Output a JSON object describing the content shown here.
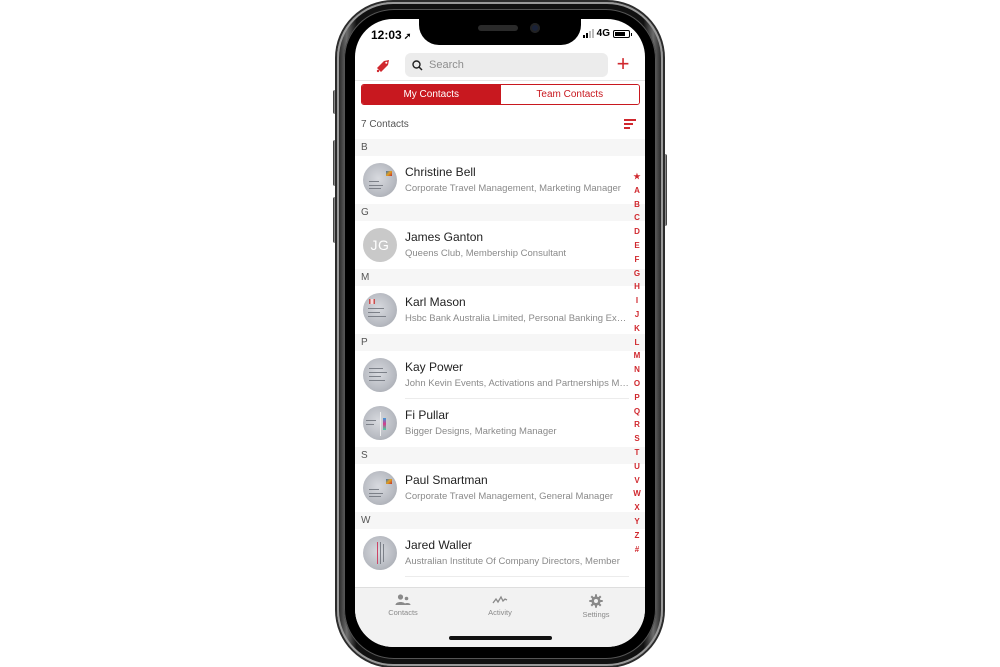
{
  "status_bar": {
    "time": "12:03",
    "location_glyph": "➚",
    "network": "4G",
    "battery_level": 0.8
  },
  "top_bar": {
    "left_icon": "tag-icon",
    "search_placeholder": "Search",
    "search_value": "",
    "add_icon": "plus-icon",
    "add_glyph": "+"
  },
  "segment": {
    "tabs": [
      {
        "label": "My Contacts",
        "active": true
      },
      {
        "label": "Team Contacts",
        "active": false
      }
    ]
  },
  "list_header": {
    "count_label": "7 Contacts",
    "sort_icon": "sort-icon"
  },
  "sections": [
    {
      "letter": "B",
      "contacts": [
        {
          "name": "Christine Bell",
          "subtitle": "Corporate Travel Management, Marketing Manager",
          "avatar": "card"
        }
      ]
    },
    {
      "letter": "G",
      "contacts": [
        {
          "name": "James Ganton",
          "subtitle": "Queens Club, Membership Consultant",
          "avatar": "initials",
          "initials": "JG"
        }
      ]
    },
    {
      "letter": "M",
      "contacts": [
        {
          "name": "Karl Mason",
          "subtitle": "Hsbc Bank Australia Limited, Personal Banking Executive",
          "avatar": "card"
        }
      ]
    },
    {
      "letter": "P",
      "contacts": [
        {
          "name": "Kay Power",
          "subtitle": "John Kevin Events, Activations and Partnerships Manager",
          "avatar": "card"
        },
        {
          "name": "Fi Pullar",
          "subtitle": "Bigger Designs, Marketing Manager",
          "avatar": "card"
        }
      ]
    },
    {
      "letter": "S",
      "contacts": [
        {
          "name": "Paul Smartman",
          "subtitle": "Corporate Travel Management, General Manager",
          "avatar": "card"
        }
      ]
    },
    {
      "letter": "W",
      "contacts": [
        {
          "name": "Jared Waller",
          "subtitle": "Australian Institute Of Company Directors, Member",
          "avatar": "card"
        }
      ]
    }
  ],
  "index": [
    "★",
    "A",
    "B",
    "C",
    "D",
    "E",
    "F",
    "G",
    "H",
    "I",
    "J",
    "K",
    "L",
    "M",
    "N",
    "O",
    "P",
    "Q",
    "R",
    "S",
    "T",
    "U",
    "V",
    "W",
    "X",
    "Y",
    "Z",
    "#"
  ],
  "tab_bar": {
    "tabs": [
      {
        "label": "Contacts",
        "icon": "people-icon"
      },
      {
        "label": "Activity",
        "icon": "activity-icon"
      },
      {
        "label": "Settings",
        "icon": "gear-icon"
      }
    ]
  },
  "colors": {
    "accent": "#c8181f",
    "section_bg": "#f6f6f6",
    "tabbar_bg": "#f2f2f2"
  }
}
